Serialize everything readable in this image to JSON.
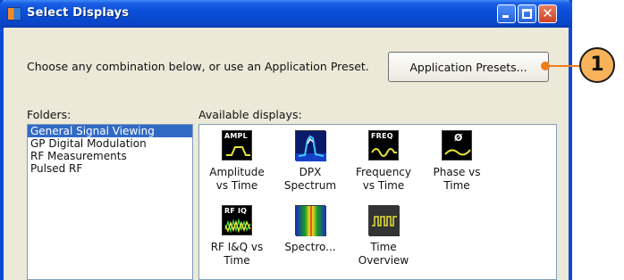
{
  "window": {
    "title": "Select Displays"
  },
  "instruction": "Choose any combination below, or use an Application Preset.",
  "presets_button": {
    "label": "Application Presets..."
  },
  "folders": {
    "label": "Folders:",
    "items": [
      "General Signal Viewing",
      "GP Digital Modulation",
      "RF Measurements",
      "Pulsed RF"
    ],
    "selected_index": 0
  },
  "available": {
    "label": "Available displays:",
    "items": [
      {
        "line1": "Amplitude",
        "line2": "vs Time",
        "icon": "ampl-icon",
        "tag": "AMPL"
      },
      {
        "line1": "DPX",
        "line2": "Spectrum",
        "icon": "dpx-icon",
        "tag": ""
      },
      {
        "line1": "Frequency",
        "line2": "vs Time",
        "icon": "freq-icon",
        "tag": "FREQ"
      },
      {
        "line1": "Phase vs",
        "line2": "Time",
        "icon": "phase-icon",
        "tag": "Ø"
      },
      {
        "line1": "RF I&Q vs",
        "line2": "Time",
        "icon": "rfiq-icon",
        "tag": "RF IQ"
      },
      {
        "line1": "Spectro...",
        "line2": "",
        "icon": "spectrogram-icon",
        "tag": ""
      },
      {
        "line1": "Time",
        "line2": "Overview",
        "icon": "time-overview-icon",
        "tag": ""
      }
    ]
  },
  "callout": {
    "number": "1"
  },
  "colors": {
    "titlebar": "#0a4fd9",
    "selection": "#316ac5",
    "callout": "#f8b25a",
    "callout_line": "#f07d1a"
  }
}
